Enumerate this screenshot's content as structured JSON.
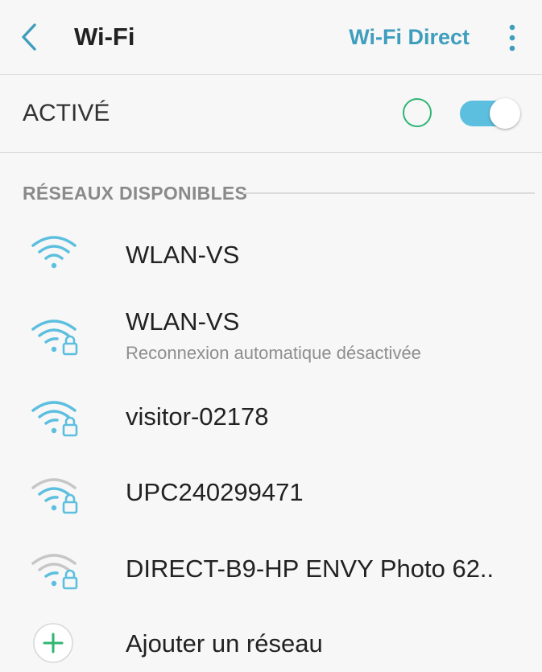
{
  "header": {
    "title": "Wi-Fi",
    "wifi_direct_label": "Wi-Fi Direct",
    "accent_color": "#3f9ebd"
  },
  "toggle": {
    "label": "ACTIVÉ",
    "enabled": true,
    "status_ring_color": "#2fb573",
    "switch_color": "#5cbfdf"
  },
  "section": {
    "title": "RÉSEAUX DISPONIBLES"
  },
  "networks": [
    {
      "name": "WLAN-VS",
      "subtitle": "",
      "secured": false,
      "signal_icon": "wifi-signal-icon",
      "color": "#5cbfdf"
    },
    {
      "name": "WLAN-VS",
      "subtitle": "Reconnexion automatique désactivée",
      "secured": true,
      "signal_icon": "wifi-lock-icon",
      "color": "#5cbfdf"
    },
    {
      "name": "visitor-02178",
      "subtitle": "",
      "secured": true,
      "signal_icon": "wifi-lock-icon",
      "color": "#5cbfdf"
    },
    {
      "name": "UPC240299471",
      "subtitle": "",
      "secured": true,
      "signal_icon": "wifi-lock-icon",
      "color": "#bdbdbd"
    },
    {
      "name": "DIRECT-B9-HP ENVY Photo 62..",
      "subtitle": "",
      "secured": true,
      "signal_icon": "wifi-lock-icon",
      "color": "#bdbdbd"
    }
  ],
  "add_network": {
    "label": "Ajouter un réseau",
    "icon": "plus-icon",
    "icon_color": "#2fb573"
  }
}
